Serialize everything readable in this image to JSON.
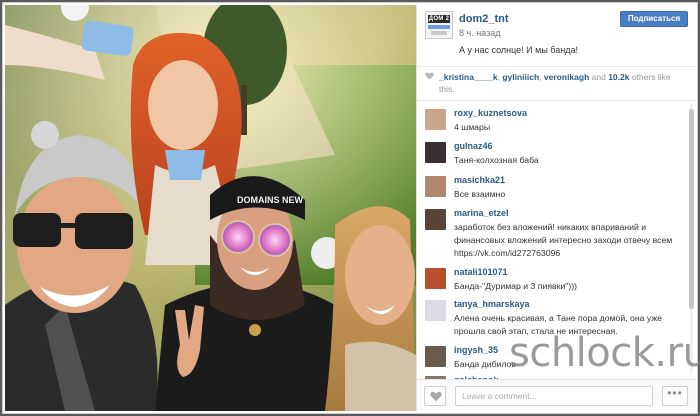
{
  "post": {
    "username": "dom2_tnt",
    "time_ago": "8 ч. назад",
    "caption": "А у нас солнце! И мы банда!",
    "follow_label": "Подписаться",
    "logo_text": "ДОМ 2"
  },
  "likes": {
    "names": [
      "_kristina____k",
      "gyliniiich",
      "veronikagh"
    ],
    "joiner_1": ", ",
    "joiner_2": ", ",
    "joiner_3": " and ",
    "count": "10.2k",
    "suffix": " others like this."
  },
  "comments": [
    {
      "user": "roxy_kuznetsova",
      "text": "4 шмары",
      "avatar_color": "#c9a58c"
    },
    {
      "user": "gulnaz46",
      "text": "Таня-колхозная баба",
      "avatar_color": "#3b3030"
    },
    {
      "user": "masichka21",
      "text": "Все взаимно",
      "avatar_color": "#b0876d"
    },
    {
      "user": "marina_etzel",
      "text": "заработок без вложений! никаких впариваний и финансовых вложений интересно заходи отвечу всем https://vk.com/id272763096",
      "avatar_color": "#5a4438"
    },
    {
      "user": "natali101071",
      "text": "Банда-\"Дуримар и 3 пиявки\")))",
      "avatar_color": "#b8502e"
    },
    {
      "user": "tanya_hmarskaya",
      "text": "Алена очень красивая, а Тане пора домой, она уже прошла свой этап, стала не интересная.",
      "avatar_color": "#d9dde3"
    },
    {
      "user": "ingysh_35",
      "text": "Банда дибилов",
      "avatar_color": "#6b5a4e"
    },
    {
      "user": "galchenok",
      "text": "",
      "avatar_color": "#8a7666"
    }
  ],
  "footer": {
    "comment_placeholder": "Leave a comment...",
    "more_label": "•••"
  },
  "watermark": "schlock.ru",
  "photo_hat_text": "DOMAINS NEW",
  "colors": {
    "link": "#2c5a85",
    "follow_button": "#4a7ec2",
    "muted": "#999999"
  }
}
